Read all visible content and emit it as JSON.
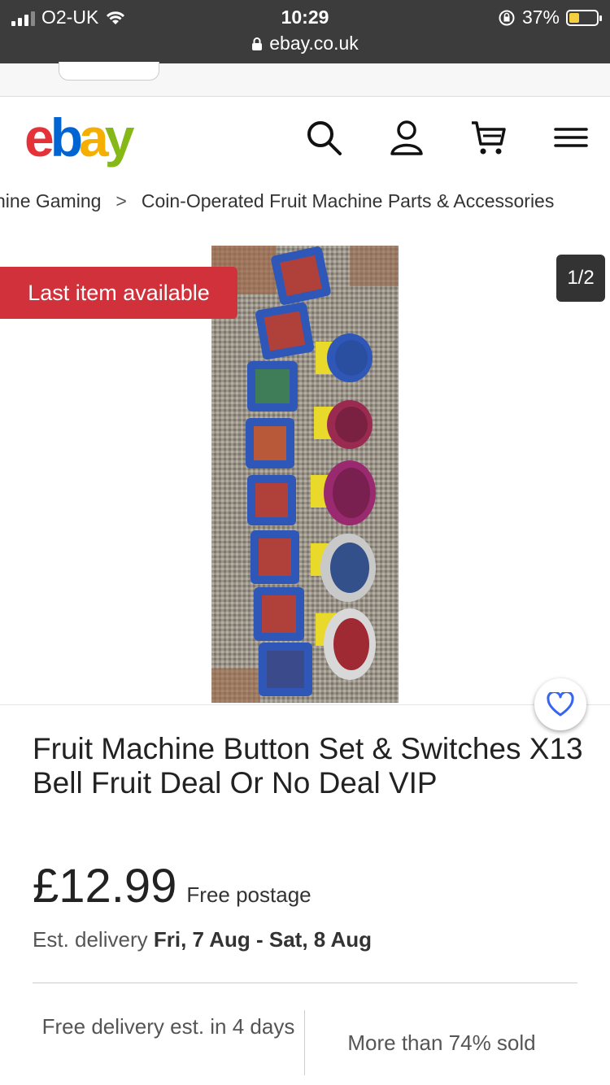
{
  "status_bar": {
    "carrier": "O2-UK",
    "time": "10:29",
    "battery_percent": "37%",
    "battery_level": 0.37,
    "url": "ebay.co.uk"
  },
  "header": {
    "logo": {
      "e": "e",
      "b": "b",
      "a": "a",
      "y": "y"
    }
  },
  "breadcrumb": {
    "items": [
      "hine Gaming",
      "Coin-Operated Fruit Machine Parts & Accessories"
    ],
    "separator": ">"
  },
  "gallery": {
    "badge": "Last item available",
    "counter": "1/2"
  },
  "product": {
    "title": "Fruit Machine Button Set & Switches X13 Bell Fruit Deal Or No Deal VIP",
    "price": "£12.99",
    "postage": "Free postage",
    "delivery_prefix": "Est. delivery",
    "delivery_dates": "Fri, 7 Aug - Sat, 8 Aug"
  },
  "highlights": {
    "left": "Free delivery est. in 4 days",
    "right": "More than 74% sold"
  },
  "colors": {
    "badge_red": "#d1313a",
    "ebay_red": "#e53238",
    "ebay_blue": "#0064d2",
    "ebay_yellow": "#f5af02",
    "ebay_green": "#86b817",
    "watch_blue": "#3665f3"
  }
}
